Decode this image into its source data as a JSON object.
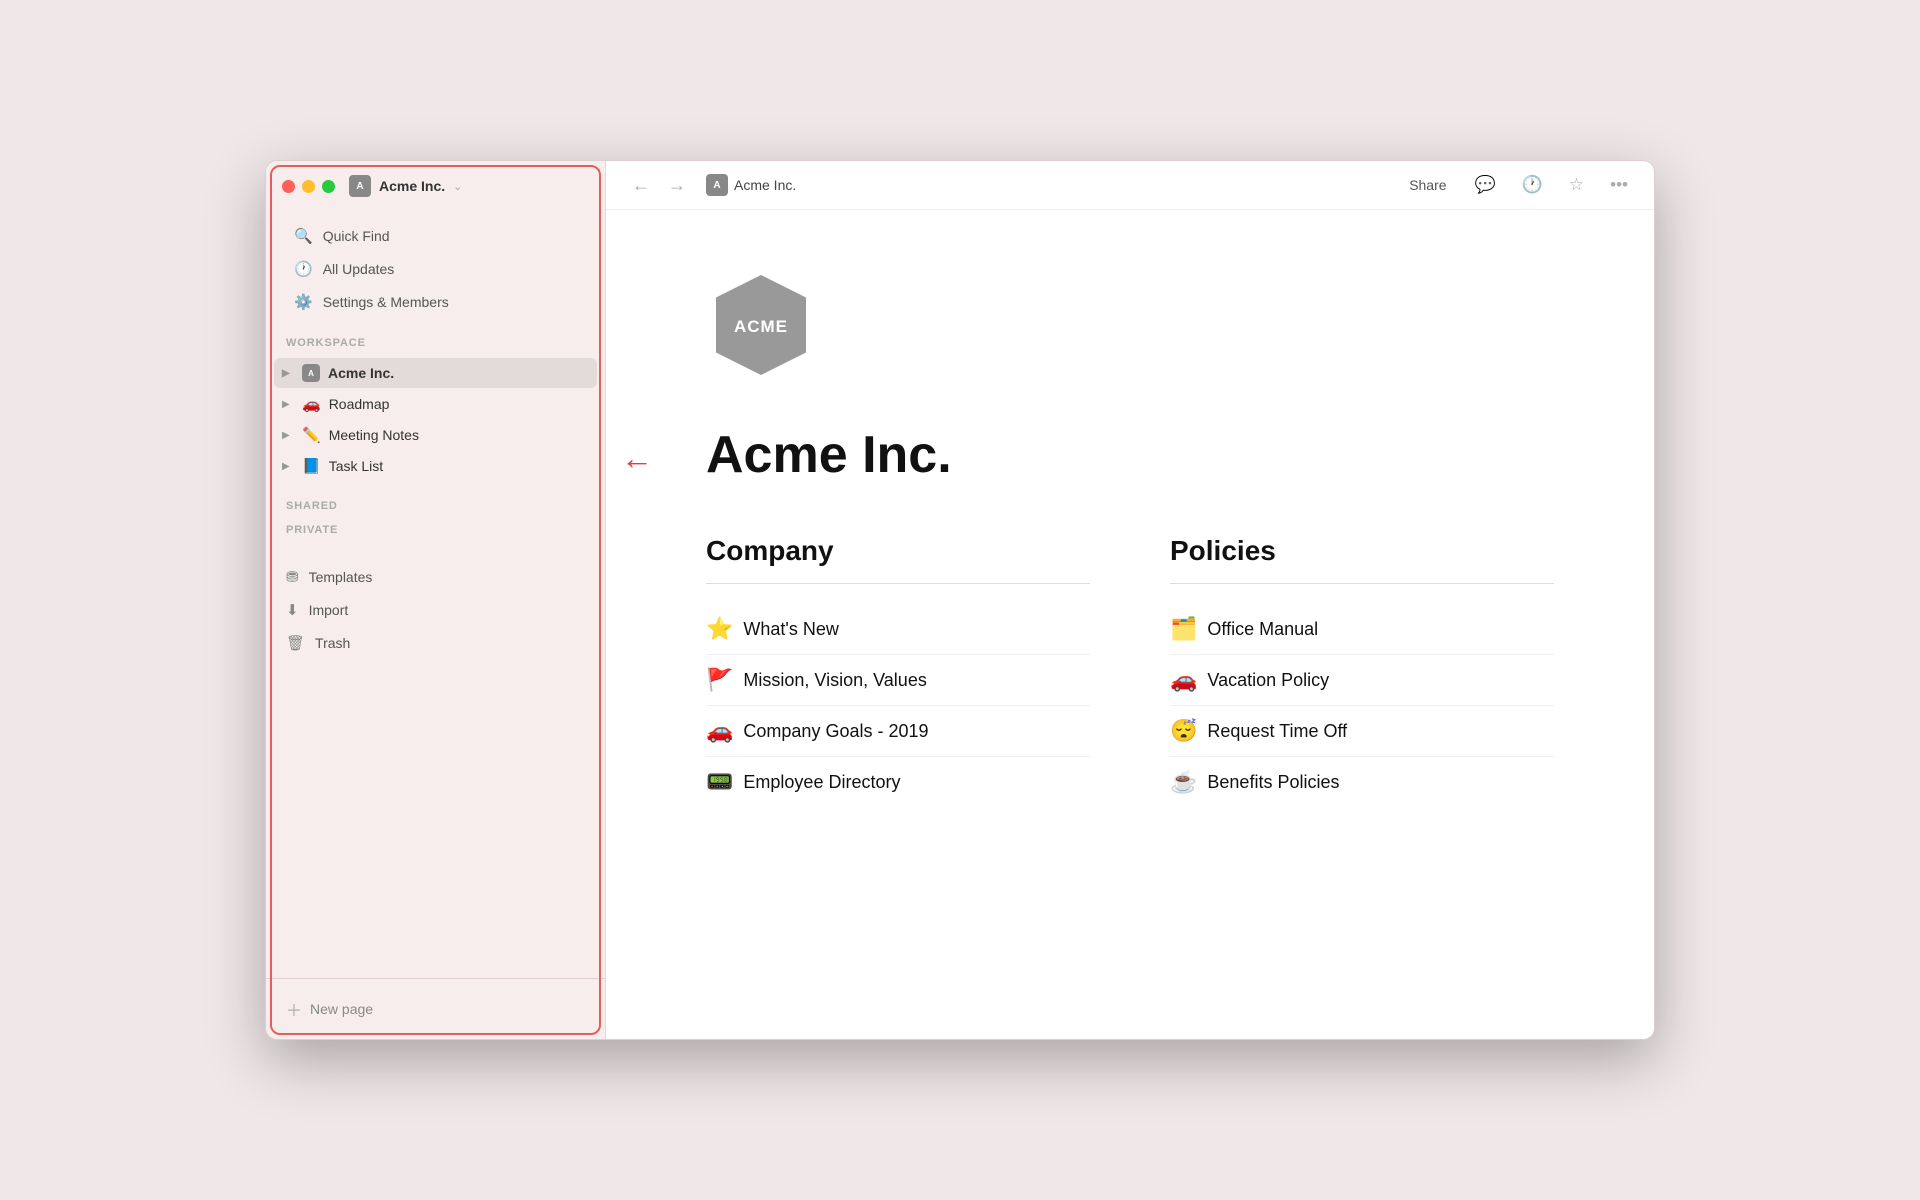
{
  "window": {
    "title": "Acme Inc."
  },
  "sidebar": {
    "workspace_label": "WORKSPACE",
    "shared_label": "SHARED",
    "private_label": "PRIVATE",
    "nav_items": [
      {
        "id": "quick-find",
        "icon": "🔍",
        "label": "Quick Find"
      },
      {
        "id": "all-updates",
        "icon": "🕐",
        "label": "All Updates"
      },
      {
        "id": "settings",
        "icon": "⚙️",
        "label": "Settings & Members"
      }
    ],
    "workspace_items": [
      {
        "id": "acme-inc",
        "icon": "acme",
        "label": "Acme Inc.",
        "active": true
      },
      {
        "id": "roadmap",
        "icon": "🚗",
        "label": "Roadmap"
      },
      {
        "id": "meeting-notes",
        "icon": "✏️",
        "label": "Meeting Notes"
      },
      {
        "id": "task-list",
        "icon": "📘",
        "label": "Task List"
      }
    ],
    "bottom_items": [
      {
        "id": "templates",
        "icon": "🎭",
        "label": "Templates"
      },
      {
        "id": "import",
        "icon": "⬇️",
        "label": "Import"
      },
      {
        "id": "trash",
        "icon": "🗑️",
        "label": "Trash"
      }
    ],
    "new_page_label": "New page",
    "account_label": "Acme Inc."
  },
  "topbar": {
    "breadcrumb_icon": "acme",
    "breadcrumb_label": "Acme Inc.",
    "share_label": "Share",
    "back_label": "←",
    "forward_label": "→"
  },
  "page": {
    "title": "Acme Inc.",
    "company_section": {
      "heading": "Company",
      "links": [
        {
          "emoji": "⭐",
          "label": "What's New"
        },
        {
          "emoji": "🚩",
          "label": "Mission, Vision, Values"
        },
        {
          "emoji": "🚗",
          "label": "Company Goals - 2019"
        },
        {
          "emoji": "📟",
          "label": "Employee Directory"
        }
      ]
    },
    "policies_section": {
      "heading": "Policies",
      "links": [
        {
          "emoji": "🗂️",
          "label": "Office Manual"
        },
        {
          "emoji": "🚗",
          "label": "Vacation Policy"
        },
        {
          "emoji": "😴",
          "label": "Request Time Off"
        },
        {
          "emoji": "☕",
          "label": "Benefits Policies"
        }
      ]
    }
  }
}
